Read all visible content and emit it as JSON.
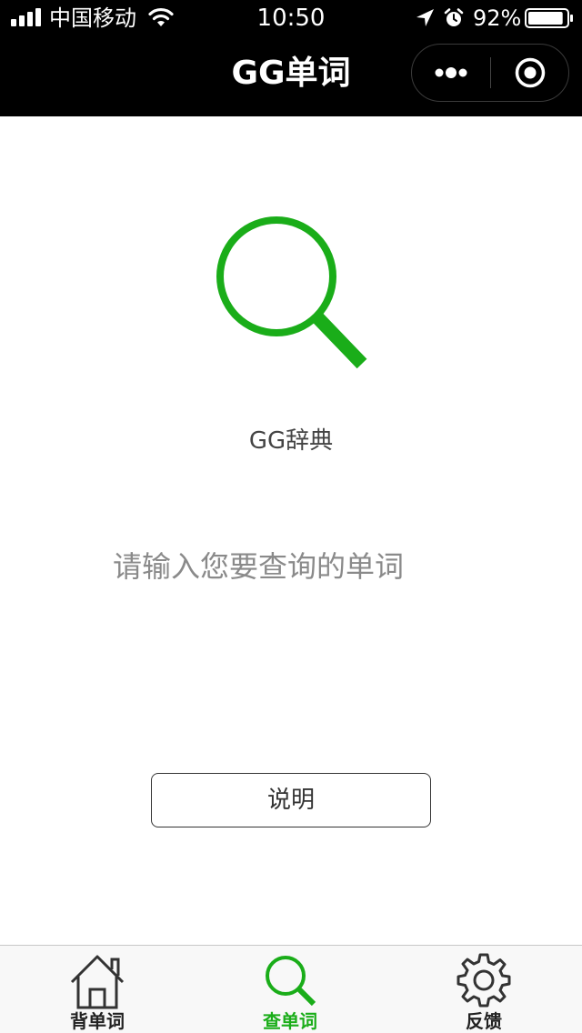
{
  "status_bar": {
    "carrier": "中国移动",
    "time": "10:50",
    "battery_percent": "92%",
    "battery_level": 0.92
  },
  "nav": {
    "title": "GG单词",
    "more_icon": "more-dots-icon",
    "close_icon": "target-circle-icon"
  },
  "main": {
    "hero_icon": "magnifier-icon",
    "hero_color": "#1aad19",
    "dict_label": "GG辞典",
    "search": {
      "placeholder": "请输入您要查询的单词",
      "value": ""
    },
    "explain_button": "说明"
  },
  "tabbar": {
    "active_color": "#1aad19",
    "tabs": [
      {
        "label": "背单词",
        "icon": "house-icon",
        "active": false
      },
      {
        "label": "查单词",
        "icon": "magnifier-icon",
        "active": true
      },
      {
        "label": "反馈",
        "icon": "gear-icon",
        "active": false
      }
    ]
  }
}
